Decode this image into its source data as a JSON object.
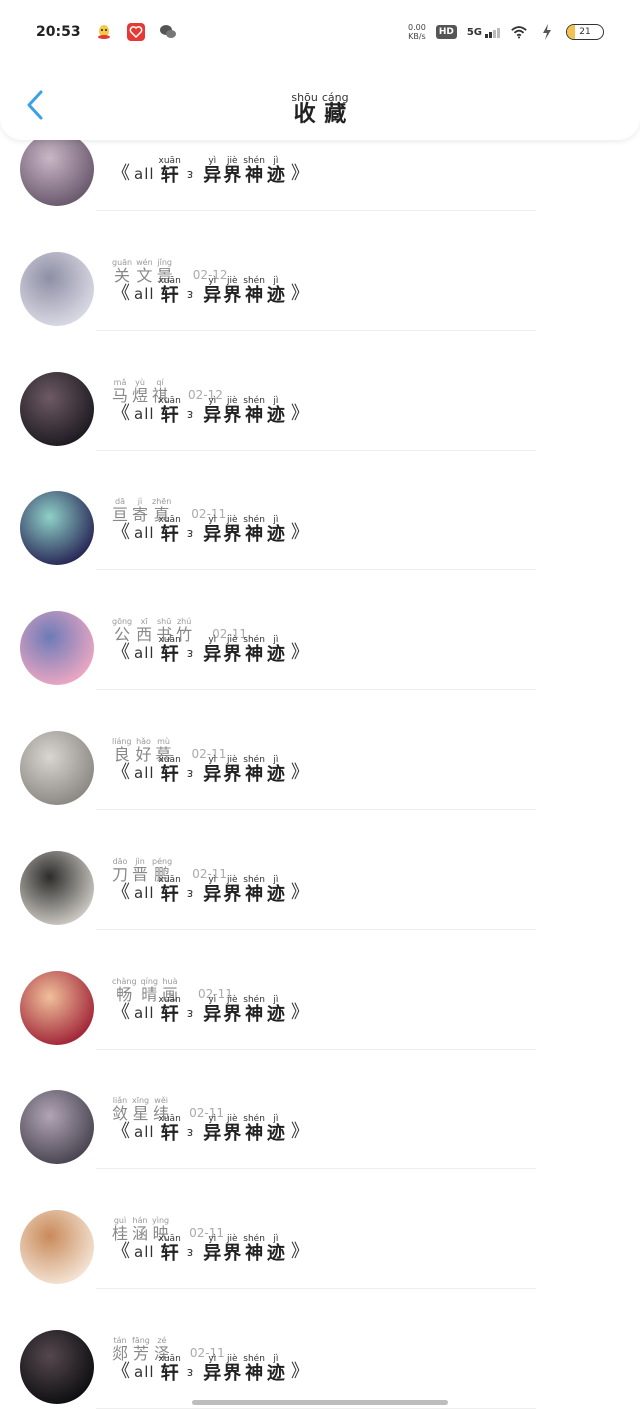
{
  "status_bar": {
    "time": "20:53",
    "net_speed_value": "0.00",
    "net_speed_unit": "KB/s",
    "hd": "HD",
    "network": "5G",
    "battery": "21",
    "battery_level_percent": 21
  },
  "header": {
    "title": [
      {
        "hz": "收",
        "py": "shōu"
      },
      {
        "hz": "藏",
        "py": "cáng"
      }
    ]
  },
  "book_title": {
    "open": "《",
    "latin": "all",
    "xuan": {
      "hz": "轩",
      "py": "xuān"
    },
    "separator": "ᴈ",
    "words": [
      {
        "hz": "异",
        "py": "yì"
      },
      {
        "hz": "界",
        "py": "jiè"
      },
      {
        "hz": "神",
        "py": "shén"
      },
      {
        "hz": "迹",
        "py": "jì"
      }
    ],
    "close": "》"
  },
  "favorites": [
    {
      "name": [],
      "date": "",
      "avatar_colors": [
        "#6b5a6e",
        "#c9b7c7"
      ]
    },
    {
      "name": [
        {
          "hz": "关",
          "py": "guān"
        },
        {
          "hz": "文",
          "py": "wén"
        },
        {
          "hz": "景",
          "py": "jǐng"
        }
      ],
      "date": "02-12",
      "avatar_colors": [
        "#d8d8e4",
        "#8f8fa5"
      ]
    },
    {
      "name": [
        {
          "hz": "马",
          "py": "mǎ"
        },
        {
          "hz": "煜",
          "py": "yù"
        },
        {
          "hz": "祺",
          "py": "qí"
        }
      ],
      "date": "02-12",
      "avatar_colors": [
        "#1f1b22",
        "#6d5a63"
      ]
    },
    {
      "name": [
        {
          "hz": "亘",
          "py": "dā"
        },
        {
          "hz": "寄",
          "py": "jì"
        },
        {
          "hz": "真",
          "py": "zhēn"
        }
      ],
      "date": "02-11",
      "avatar_colors": [
        "#2a2a58",
        "#8fd0c8"
      ]
    },
    {
      "name": [
        {
          "hz": "公",
          "py": "gōng"
        },
        {
          "hz": "西",
          "py": "xī"
        },
        {
          "hz": "书",
          "py": "shū"
        },
        {
          "hz": "竹",
          "py": "zhú"
        }
      ],
      "date": "02-11",
      "avatar_colors": [
        "#e9a6c2",
        "#6c7bb8"
      ]
    },
    {
      "name": [
        {
          "hz": "良",
          "py": "liáng"
        },
        {
          "hz": "好",
          "py": "hǎo"
        },
        {
          "hz": "慕",
          "py": "mù"
        }
      ],
      "date": "02-11",
      "avatar_colors": [
        "#8d8a86",
        "#d9d5cf"
      ]
    },
    {
      "name": [
        {
          "hz": "刀",
          "py": "dāo"
        },
        {
          "hz": "晋",
          "py": "jìn"
        },
        {
          "hz": "鹏",
          "py": "péng"
        }
      ],
      "date": "02-11",
      "avatar_colors": [
        "#c9c6c0",
        "#2d2c2a"
      ]
    },
    {
      "name": [
        {
          "hz": "畅",
          "py": "chàng"
        },
        {
          "hz": "晴",
          "py": "qíng"
        },
        {
          "hz": "画",
          "py": "huà"
        }
      ],
      "date": "02-11",
      "avatar_colors": [
        "#a2283a",
        "#f0c09b"
      ]
    },
    {
      "name": [
        {
          "hz": "敛",
          "py": "liǎn"
        },
        {
          "hz": "星",
          "py": "xīng"
        },
        {
          "hz": "纬",
          "py": "wěi"
        }
      ],
      "date": "02-11",
      "avatar_colors": [
        "#4b4652",
        "#b1a5b6"
      ]
    },
    {
      "name": [
        {
          "hz": "桂",
          "py": "guì"
        },
        {
          "hz": "涵",
          "py": "hán"
        },
        {
          "hz": "映",
          "py": "yìng"
        }
      ],
      "date": "02-11",
      "avatar_colors": [
        "#f3e2d2",
        "#c98a5a"
      ]
    },
    {
      "name": [
        {
          "hz": "郯",
          "py": "tán"
        },
        {
          "hz": "芳",
          "py": "fāng"
        },
        {
          "hz": "泽",
          "py": "zé"
        }
      ],
      "date": "02-11",
      "avatar_colors": [
        "#0f0f12",
        "#55484e"
      ]
    }
  ],
  "colors": {
    "back_arrow": "#3aa0e8",
    "divider": "#eeeeee"
  }
}
